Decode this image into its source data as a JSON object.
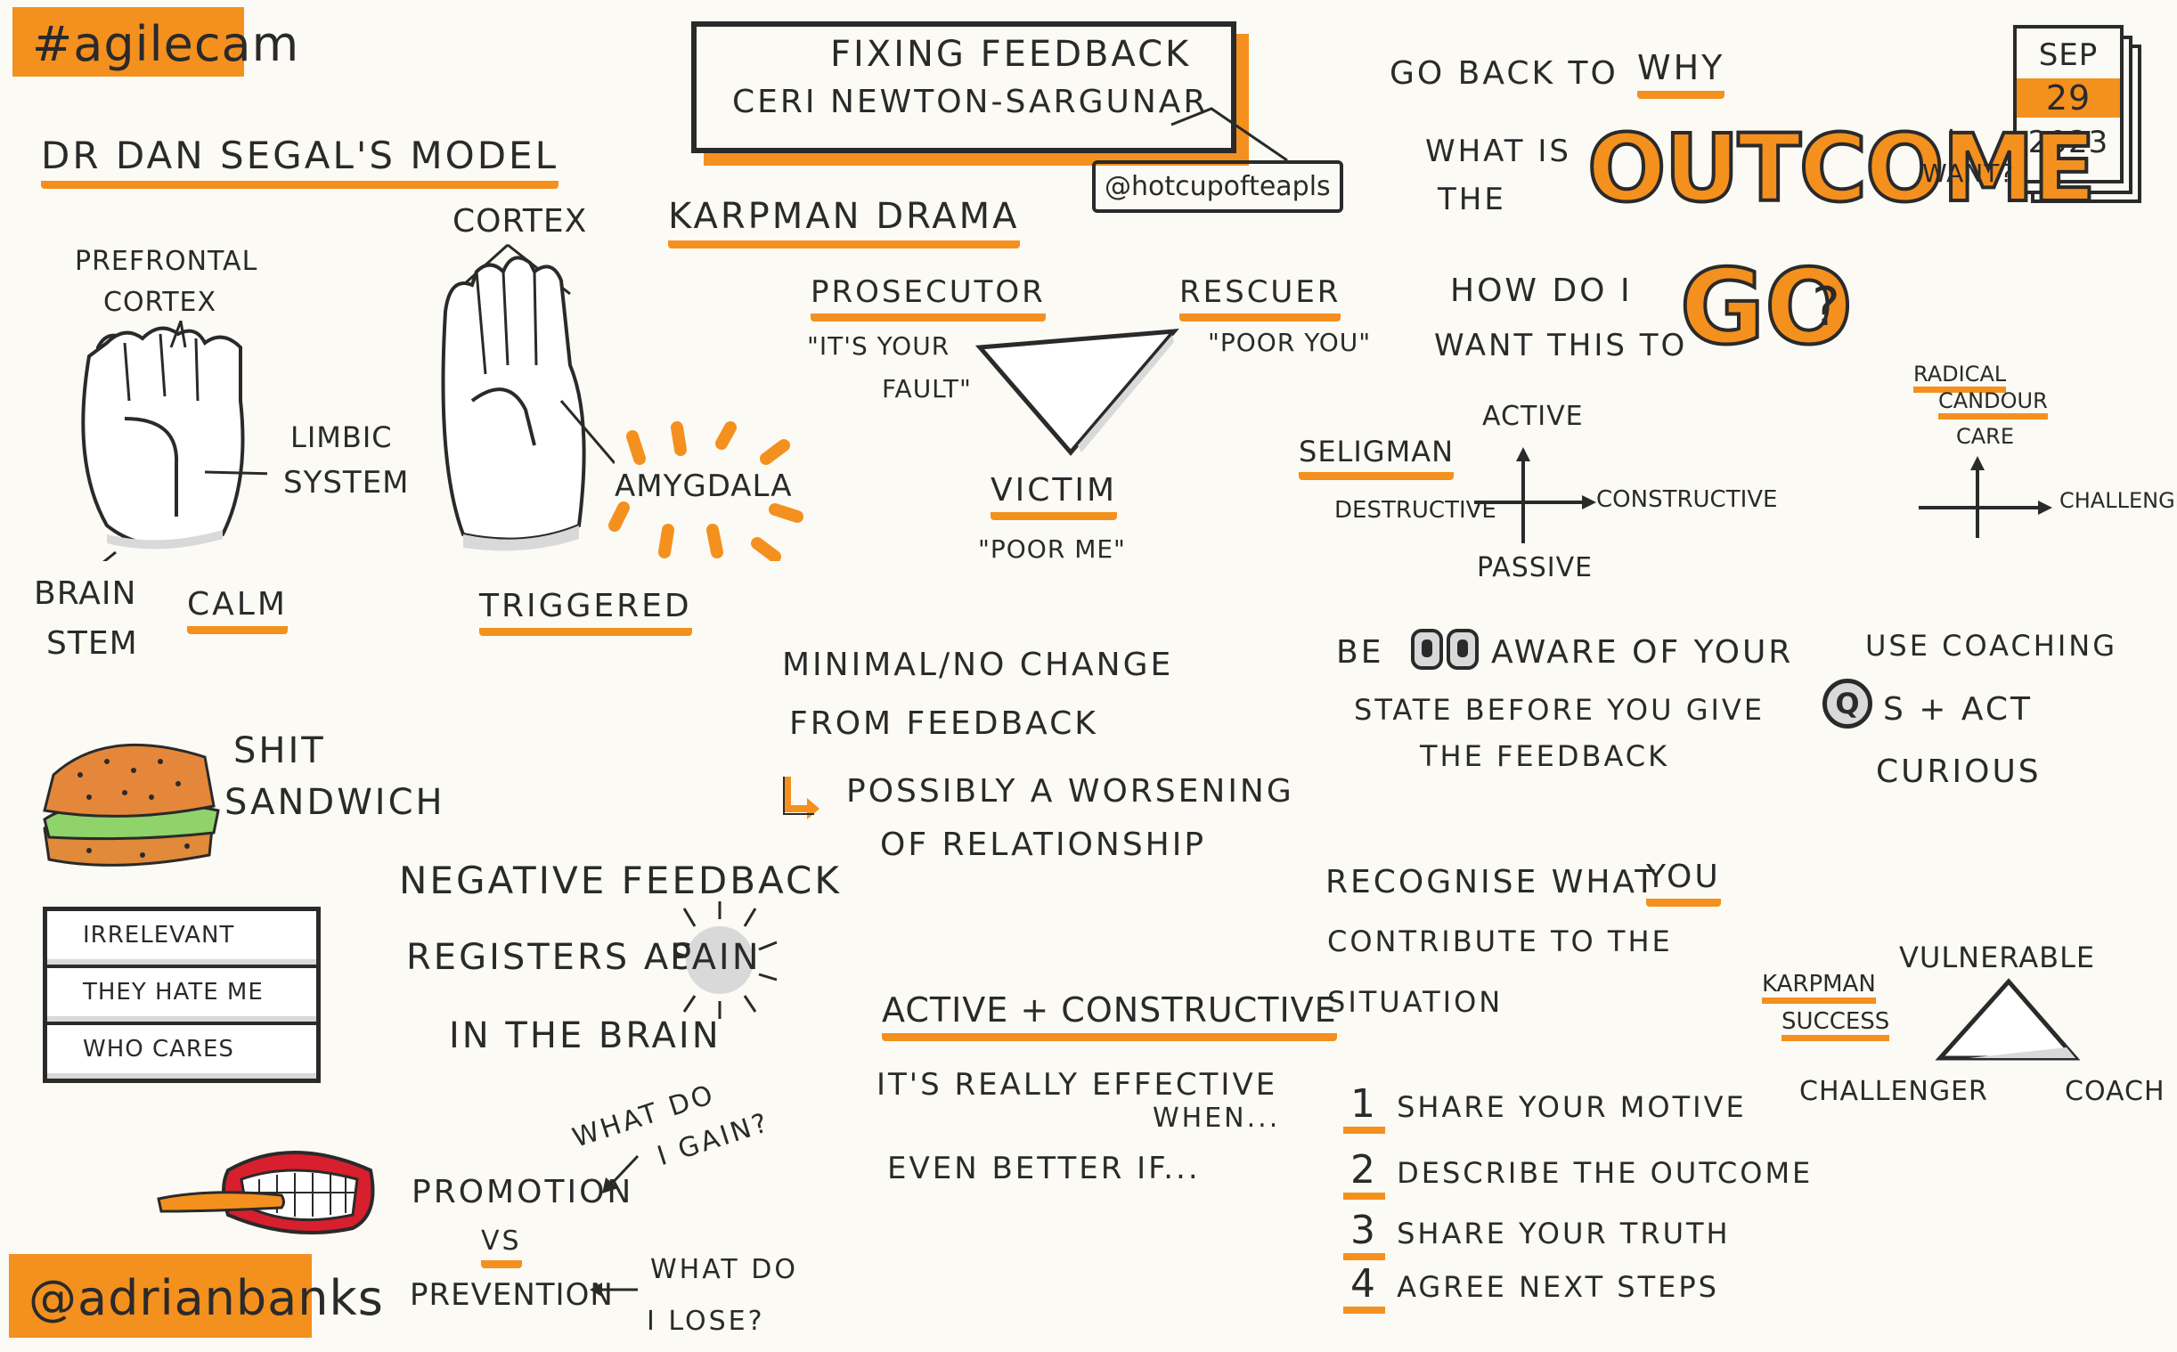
{
  "tags": {
    "hashtag": "#agilecam",
    "author": "@adrianbanks"
  },
  "title_box": {
    "line1": "FIXING FEEDBACK",
    "line2": "CERI NEWTON-SARGUNAR",
    "handle": "@hotcupofteapls"
  },
  "calendar": {
    "month": "SEP",
    "day": "29",
    "year": "2023"
  },
  "siegel": {
    "heading": "DR DAN SEGAL'S MODEL",
    "prefrontal": "PREFRONTAL",
    "cortex_small": "CORTEX",
    "limbic1": "LIMBIC",
    "limbic2": "SYSTEM",
    "brain": "BRAIN",
    "stem": "STEM",
    "calm": "CALM",
    "cortex": "CORTEX",
    "amygdala": "AMYGDALA",
    "triggered": "TRIGGERED"
  },
  "karpman": {
    "heading": "KARPMAN DRAMA",
    "prosecutor": "PROSECUTOR",
    "prosecutor_quote1": "\"IT'S YOUR",
    "prosecutor_quote2": "FAULT\"",
    "rescuer": "RESCUER",
    "rescuer_quote": "\"POOR YOU\"",
    "victim": "VICTIM",
    "victim_quote": "\"POOR ME\""
  },
  "why": {
    "go_back": "GO BACK TO",
    "why": "WHY",
    "what_is": "WHAT IS",
    "the": "THE",
    "outcome": "OUTCOME",
    "i": "I",
    "want": "WANT?",
    "how_do_i": "HOW DO I",
    "want_this_to": "WANT THIS TO",
    "go": "GO",
    "qmark": "?"
  },
  "seligman": {
    "heading": "SELIGMAN",
    "active": "ACTIVE",
    "passive": "PASSIVE",
    "destructive": "DESTRUCTIVE",
    "constructive": "CONSTRUCTIVE"
  },
  "radical": {
    "line1": "RADICAL",
    "line2": "CANDOUR",
    "care": "CARE",
    "challenge": "CHALLENGE"
  },
  "sandwich": {
    "line1": "SHIT",
    "line2": "SANDWICH"
  },
  "list": {
    "items": [
      "IRRELEVANT",
      "THEY HATE ME",
      "WHO CARES"
    ]
  },
  "minimal": {
    "line1": "MINIMAL/NO CHANGE",
    "line2": "FROM FEEDBACK",
    "line3": "POSSIBLY A WORSENING",
    "line4": "OF RELATIONSHIP"
  },
  "aware": {
    "be": "BE",
    "rest": "AWARE OF YOUR",
    "line2": "STATE BEFORE YOU GIVE",
    "line3": "THE FEEDBACK"
  },
  "coaching": {
    "line1": "USE COACHING",
    "q": "Q",
    "line2": "S + ACT",
    "line3": "CURIOUS"
  },
  "negative": {
    "line1": "NEGATIVE FEEDBACK",
    "line2a": "REGISTERS AS",
    "pain": "PAIN",
    "line3": "IN THE BRAIN"
  },
  "recognise": {
    "line1a": "RECOGNISE WHAT",
    "you": "YOU",
    "line2": "CONTRIBUTE TO THE",
    "line3": "SITUATION"
  },
  "karpman_success": {
    "line1": "KARPMAN",
    "line2": "SUCCESS",
    "vulnerable": "VULNERABLE",
    "challenger": "CHALLENGER",
    "coach": "COACH"
  },
  "active_constructive": {
    "heading": "ACTIVE + CONSTRUCTIVE",
    "line1": "IT'S REALLY EFFECTIVE",
    "line1b": "WHEN...",
    "line2": "EVEN BETTER IF..."
  },
  "promotion": {
    "what_gain1": "WHAT DO",
    "what_gain2": "I GAIN?",
    "promotion": "PROMOTION",
    "vs": "VS",
    "prevention": "PREVENTION",
    "what_lose1": "WHAT DO",
    "what_lose2": "I LOSE?"
  },
  "steps": {
    "items": [
      {
        "n": "1",
        "text": "SHARE YOUR MOTIVE"
      },
      {
        "n": "2",
        "text": "DESCRIBE THE OUTCOME"
      },
      {
        "n": "3",
        "text": "SHARE YOUR TRUTH"
      },
      {
        "n": "4",
        "text": "AGREE NEXT STEPS"
      }
    ]
  },
  "colors": {
    "accent": "#f4901e",
    "ink": "#2a2a2a",
    "paper": "#fbfaf4"
  },
  "icons": [
    "hand-fist-icon",
    "hand-open-icon",
    "sandwich-icon",
    "mouth-icon",
    "eyes-icon",
    "magnifier-q-icon",
    "calendar-icon",
    "return-arrow-icon"
  ]
}
